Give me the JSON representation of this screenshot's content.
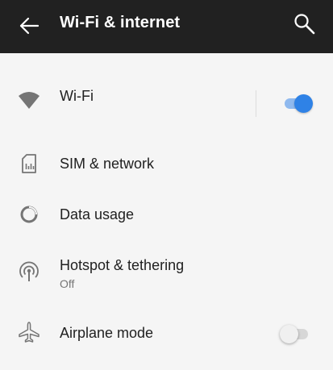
{
  "header": {
    "title": "Wi-Fi & internet",
    "back_icon": "arrow-back-icon",
    "search_icon": "search-icon"
  },
  "items": [
    {
      "label": "Wi-Fi",
      "icon": "wifi-icon",
      "toggle": "on"
    },
    {
      "label": "SIM & network",
      "icon": "sim-card-icon"
    },
    {
      "label": "Data usage",
      "icon": "data-usage-icon"
    },
    {
      "label": "Hotspot & tethering",
      "sublabel": "Off",
      "icon": "hotspot-icon"
    },
    {
      "label": "Airplane mode",
      "icon": "airplane-icon",
      "toggle": "off"
    }
  ],
  "colors": {
    "appbar": "#212121",
    "background": "#f5f5f5",
    "accent": "#2f82e6",
    "icon": "#757575"
  }
}
